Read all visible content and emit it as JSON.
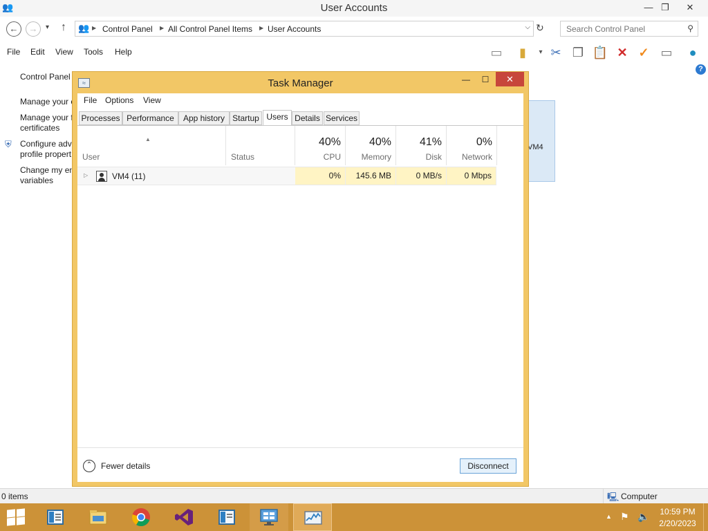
{
  "window": {
    "title": "User Accounts",
    "minimize": "—",
    "maximize": "❐",
    "close": "✕"
  },
  "address": {
    "back": "←",
    "forward": "→",
    "history": "▾",
    "up": "↑",
    "crumbs": [
      "Control Panel",
      "All Control Panel Items",
      "User Accounts"
    ],
    "dropdown": "⌵",
    "refresh": "↻"
  },
  "search": {
    "placeholder": "Search Control Panel",
    "icon": "⚲"
  },
  "menu": [
    "File",
    "Edit",
    "View",
    "Tools",
    "Help"
  ],
  "help_glyph": "?",
  "left_panel": {
    "home": "Control Panel",
    "links": [
      "Manage your c",
      "Manage your f",
      "certificates",
      "Configure adv",
      "profile propert",
      "Change my en",
      "variables"
    ]
  },
  "background_card_text": "VM4",
  "status": {
    "items": "0 items",
    "computer": "Computer"
  },
  "task_manager": {
    "title": "Task Manager",
    "icon": "≈",
    "minimize": "—",
    "maximize": "☐",
    "close": "✕",
    "menu": [
      "File",
      "Options",
      "View"
    ],
    "tabs": [
      "Processes",
      "Performance",
      "App history",
      "Startup",
      "Users",
      "Details",
      "Services"
    ],
    "active_tab": "Users",
    "columns": {
      "user": "User",
      "status": "Status",
      "cpu": {
        "pct": "40%",
        "label": "CPU"
      },
      "memory": {
        "pct": "40%",
        "label": "Memory"
      },
      "disk": {
        "pct": "41%",
        "label": "Disk"
      },
      "network": {
        "pct": "0%",
        "label": "Network"
      }
    },
    "sort_glyph": "▲",
    "rows": [
      {
        "expander": "▷",
        "name": "VM4 (11)",
        "status": "",
        "cpu": "0%",
        "memory": "145.6 MB",
        "disk": "0 MB/s",
        "network": "0 Mbps"
      }
    ],
    "fewer_details": "Fewer details",
    "fewer_glyph": "⌃",
    "disconnect": "Disconnect"
  },
  "taskbar": {
    "apps": [
      "file-explorer",
      "chrome",
      "visual-studio",
      "notepad",
      "remote-desktop",
      "task-manager"
    ],
    "tray_arrow": "▲",
    "time": "10:59 PM",
    "date": "2/20/2023"
  },
  "colors": {
    "tm_frame": "#f2c766",
    "taskbar": "#cc9238",
    "tm_close": "#c7463b",
    "highlight_cell": "#fff4c4"
  }
}
